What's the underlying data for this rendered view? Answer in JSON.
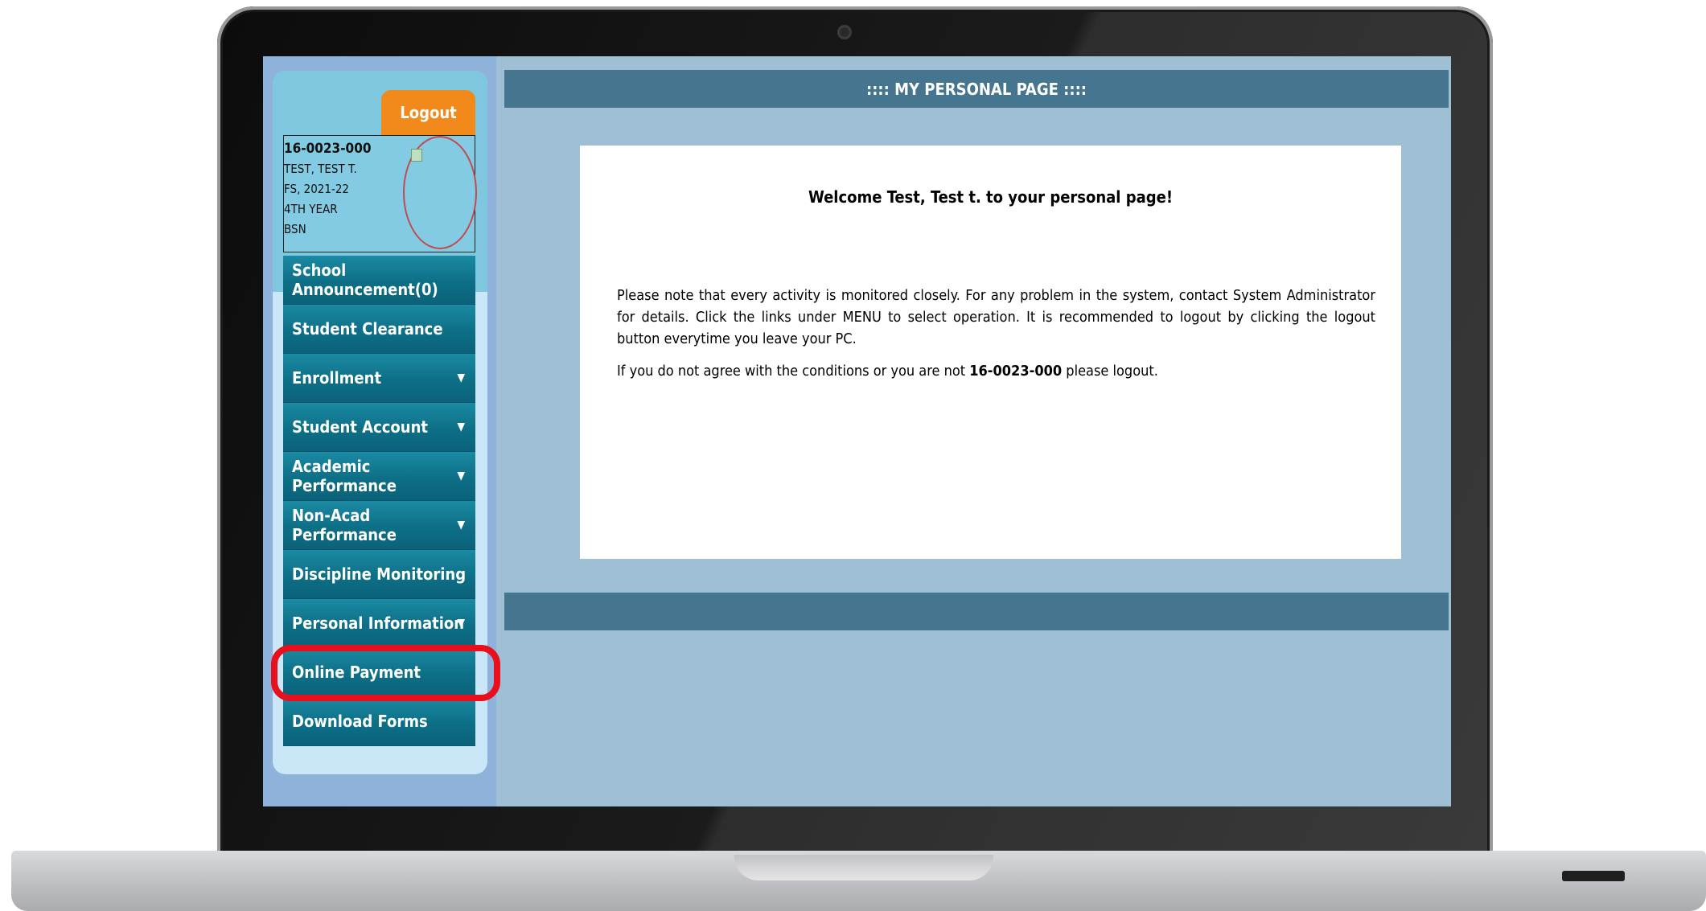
{
  "page": {
    "title": ":::: MY PERSONAL PAGE ::::"
  },
  "user": {
    "id": "16-0023-000",
    "name": "TEST, TEST T.",
    "term": "FS, 2021-22",
    "year": "4TH YEAR",
    "program": "BSN"
  },
  "header": {
    "logout_label": "Logout"
  },
  "menu": {
    "items": [
      {
        "label": "School Announcement(0)",
        "dropdown": false
      },
      {
        "label": "Student Clearance",
        "dropdown": false
      },
      {
        "label": "Enrollment",
        "dropdown": true
      },
      {
        "label": "Student Account",
        "dropdown": true
      },
      {
        "label": "Academic Performance",
        "dropdown": true
      },
      {
        "label": "Non-Acad Performance",
        "dropdown": true
      },
      {
        "label": "Discipline Monitoring",
        "dropdown": false
      },
      {
        "label": "Personal Information",
        "dropdown": true
      },
      {
        "label": "Online Payment",
        "dropdown": false,
        "highlighted": true
      },
      {
        "label": "Download Forms",
        "dropdown": false
      }
    ],
    "arrow": "▼"
  },
  "main": {
    "welcome": "Welcome Test, Test t. to your personal page!",
    "notice": "Please note that every activity is monitored closely. For any problem in the system, contact System Administrator for details. Click the links under MENU to select operation. It is recommended to logout by clicking the logout button everytime you leave your PC.",
    "agree_prefix": "If you do not agree with the conditions or you are not",
    "agree_id": "16-0023-000",
    "agree_suffix": "please logout."
  },
  "colors": {
    "accent_orange": "#f28a1b",
    "menu_teal": "#0d6f86",
    "header_bar": "#46768f",
    "highlight_red": "#e8101c"
  }
}
